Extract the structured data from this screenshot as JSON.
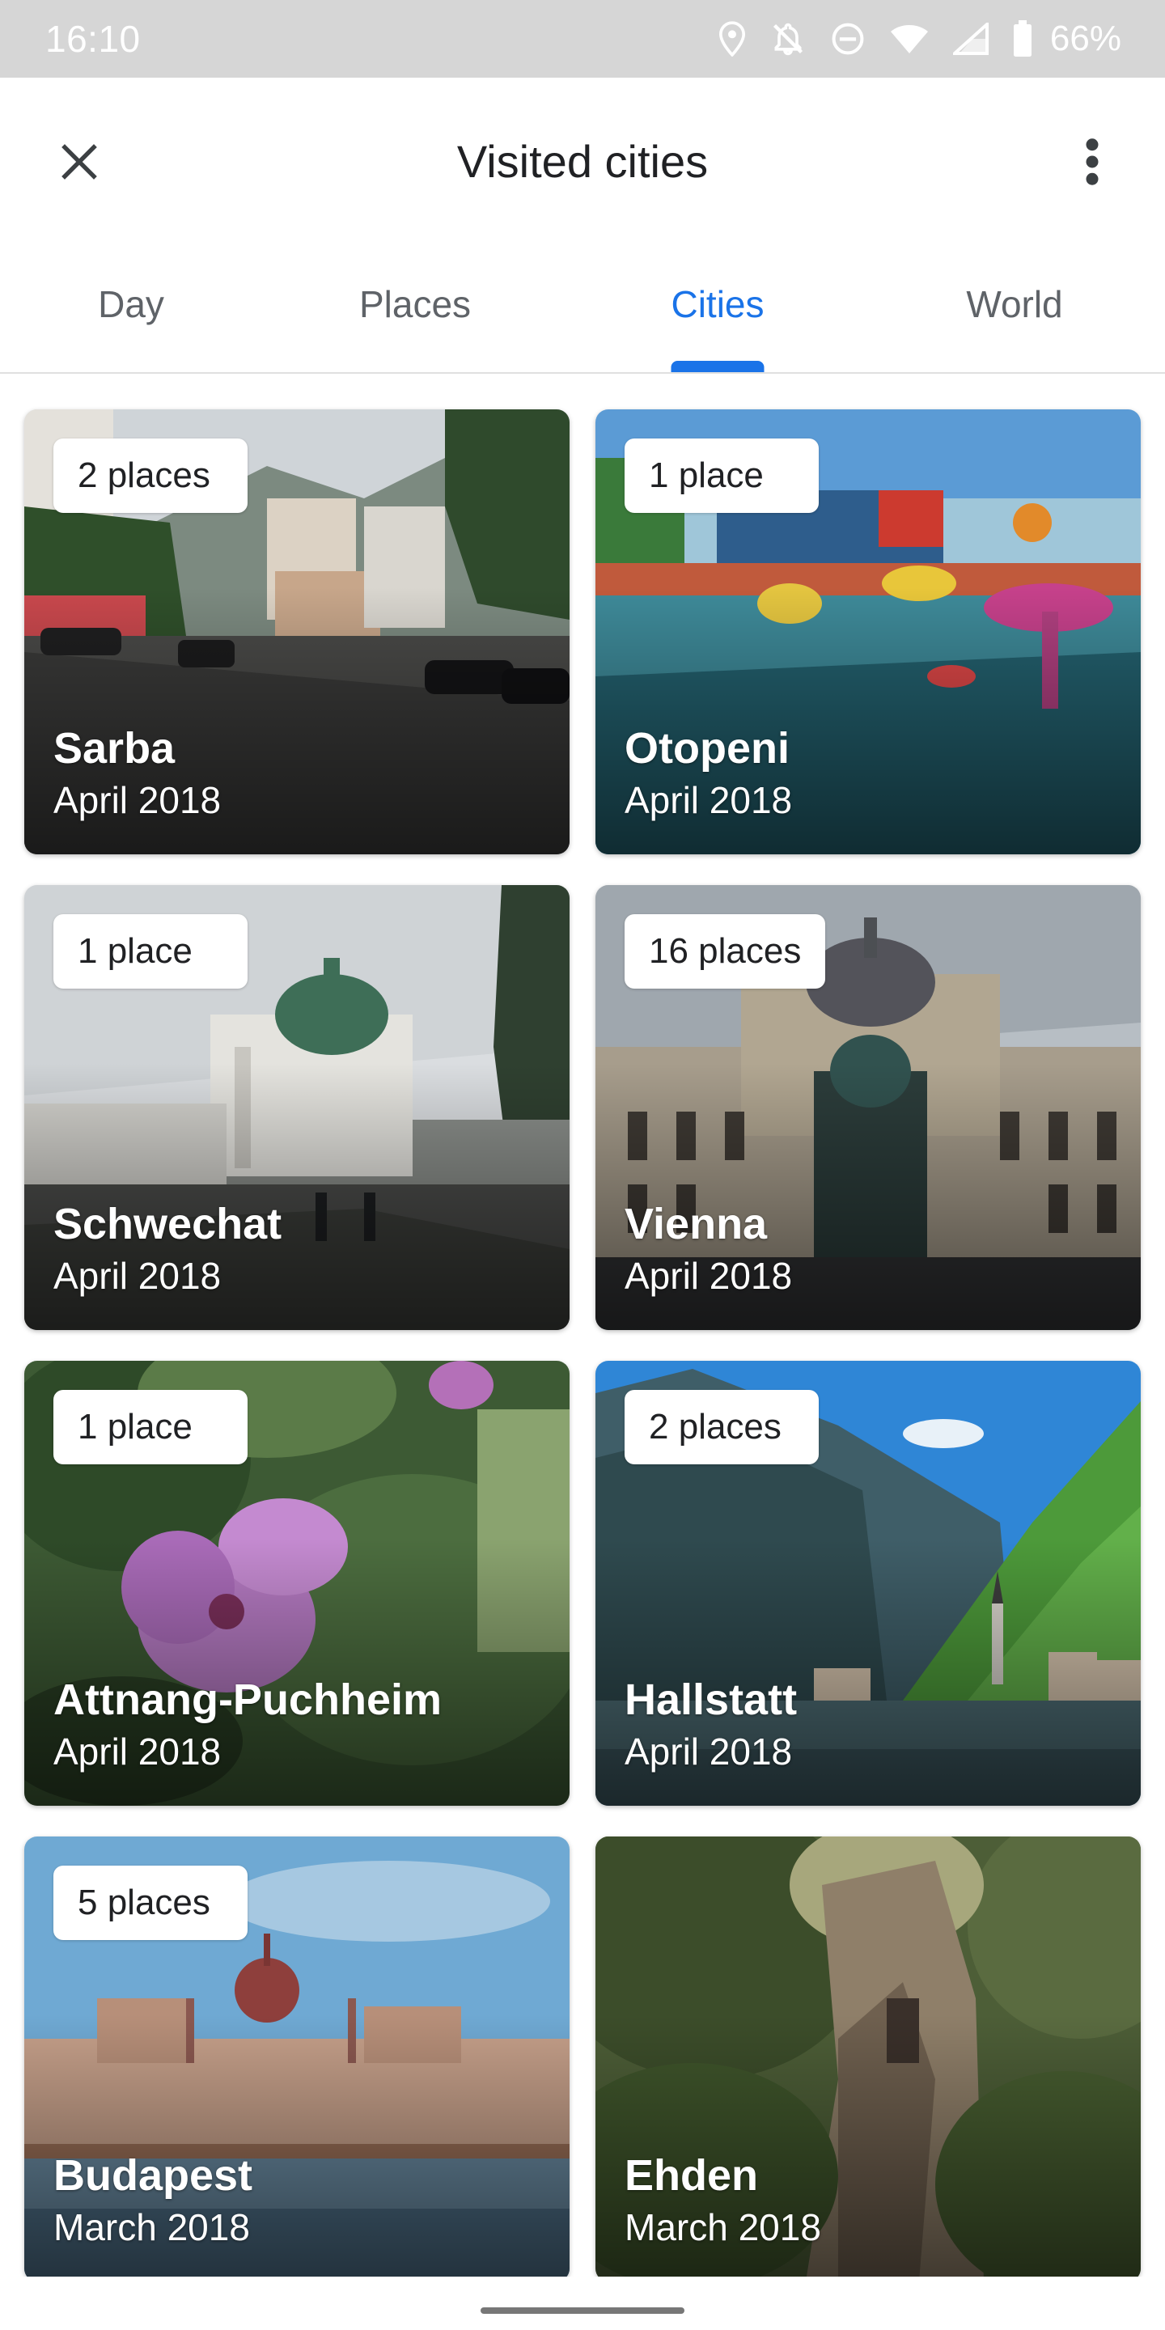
{
  "status_bar": {
    "time": "16:10",
    "battery": "66%",
    "icons": [
      "location-icon",
      "notifications-off-icon",
      "do-not-disturb-icon",
      "wifi-icon",
      "signal-icon",
      "battery-icon"
    ]
  },
  "app_bar": {
    "title": "Visited cities",
    "close_icon": "close-icon",
    "more_icon": "more-vert-icon"
  },
  "tabs": {
    "items": [
      {
        "label": "Day"
      },
      {
        "label": "Places"
      },
      {
        "label": "Cities"
      },
      {
        "label": "World"
      }
    ],
    "active": "Cities",
    "accent_color": "#1a73e8"
  },
  "cities": [
    {
      "name": "Sarba",
      "date": "April 2018",
      "count": "2 places"
    },
    {
      "name": "Otopeni",
      "date": "April 2018",
      "count": "1 place"
    },
    {
      "name": "Schwechat",
      "date": "April 2018",
      "count": "1 place"
    },
    {
      "name": "Vienna",
      "date": "April 2018",
      "count": "16 places"
    },
    {
      "name": "Attnang-Puchheim",
      "date": "April 2018",
      "count": "1 place"
    },
    {
      "name": "Hallstatt",
      "date": "April 2018",
      "count": "2 places"
    },
    {
      "name": "Budapest",
      "date": "March 2018",
      "count": "5 places"
    },
    {
      "name": "Ehden",
      "date": "March 2018",
      "count": ""
    }
  ]
}
